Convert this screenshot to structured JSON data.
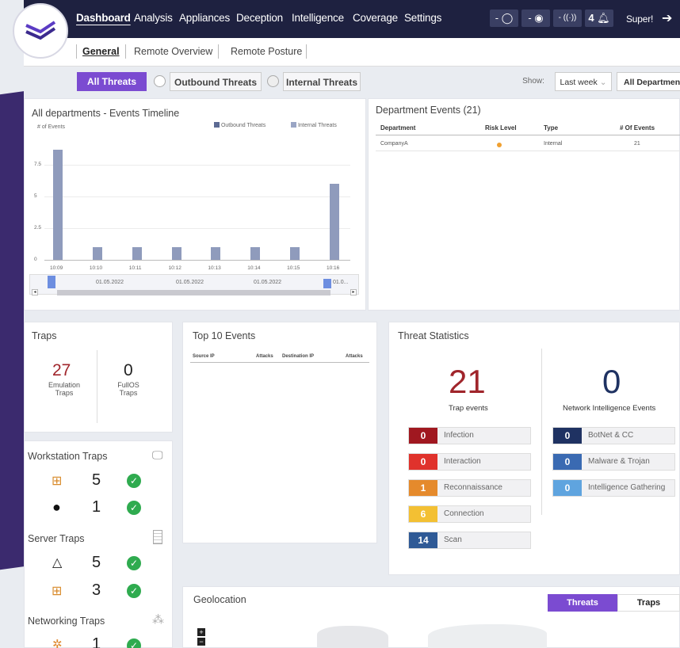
{
  "nav": {
    "items": [
      "Dashboard",
      "Analysis",
      "Appliances",
      "Deception",
      "Intelligence",
      "Coverage",
      "Settings"
    ],
    "status1": "- ◯",
    "status2": "- ◉",
    "status3": "- ((·))",
    "alerts": "4",
    "user": "Super!"
  },
  "subnav": {
    "tabs": [
      "General",
      "Remote Overview",
      "Remote Posture"
    ]
  },
  "filters": {
    "all_threats": "All Threats",
    "outbound": "Outbound Threats",
    "internal": "Internal Threats",
    "show_label": "Show:",
    "period": "Last week",
    "department": "All Departments"
  },
  "timeline": {
    "title": "All departments - Events Timeline",
    "legend_outbound": "Outbound Threats",
    "legend_internal": "Internal Threats",
    "scroll_dates": [
      "01.05.2022",
      "01.05.2022",
      "01.05.2022",
      "01.0..."
    ]
  },
  "chart_data": {
    "type": "bar",
    "title": "All departments - Events Timeline",
    "ylabel": "# of Events",
    "ylim": [
      0,
      10
    ],
    "yticks": [
      "0",
      "2.5",
      "5",
      "7.5"
    ],
    "categories": [
      "10:09",
      "10:10",
      "10:11",
      "10:12",
      "10:13",
      "10:14",
      "10:15",
      "10:16"
    ],
    "series": [
      {
        "name": "Internal Threats",
        "x": [
          10.09,
          10.1,
          10.11,
          10.12,
          10.13,
          10.14,
          10.15,
          10.16
        ],
        "values": [
          8.7,
          1,
          1,
          1,
          1,
          1,
          1,
          6
        ]
      }
    ]
  },
  "dept_events": {
    "title": "Department Events (21)",
    "headers": [
      "Department",
      "Risk Level",
      "Type",
      "# Of Events"
    ],
    "rows": [
      {
        "department": "CompanyA",
        "type": "Internal",
        "events": "21",
        "risk_color": "#f0a030"
      }
    ]
  },
  "traps": {
    "title": "Traps",
    "emulation_count": "27",
    "emulation_label": "Emulation Traps",
    "fullos_count": "0",
    "fullos_label": "FullOS Traps"
  },
  "workstation": {
    "title": "Workstation Traps",
    "windows": "5",
    "apple": "1"
  },
  "server": {
    "title": "Server Traps",
    "linux": "5",
    "windows": "3"
  },
  "networking": {
    "title": "Networking Traps",
    "count": "1"
  },
  "top10": {
    "title": "Top 10 Events",
    "headers": [
      "Source IP",
      "Attacks",
      "Destination IP",
      "Attacks"
    ]
  },
  "threat_stats": {
    "title": "Threat Statistics",
    "trap_events": "21",
    "trap_events_label": "Trap events",
    "ni_events": "0",
    "ni_events_label": "Network Intelligence Events",
    "left": [
      {
        "count": "0",
        "label": "Infection",
        "color": "#a01820"
      },
      {
        "count": "0",
        "label": "Interaction",
        "color": "#e0322c"
      },
      {
        "count": "1",
        "label": "Reconnaissance",
        "color": "#e58a2c"
      },
      {
        "count": "6",
        "label": "Connection",
        "color": "#f3c033"
      },
      {
        "count": "14",
        "label": "Scan",
        "color": "#2f5a96"
      }
    ],
    "right": [
      {
        "count": "0",
        "label": "BotNet & CC",
        "color": "#1f3262"
      },
      {
        "count": "0",
        "label": "Malware & Trojan",
        "color": "#3a6ab2"
      },
      {
        "count": "0",
        "label": "Intelligence Gathering",
        "color": "#5fa4df"
      }
    ]
  },
  "geo": {
    "title": "Geolocation",
    "tab_threats": "Threats",
    "tab_traps": "Traps"
  }
}
